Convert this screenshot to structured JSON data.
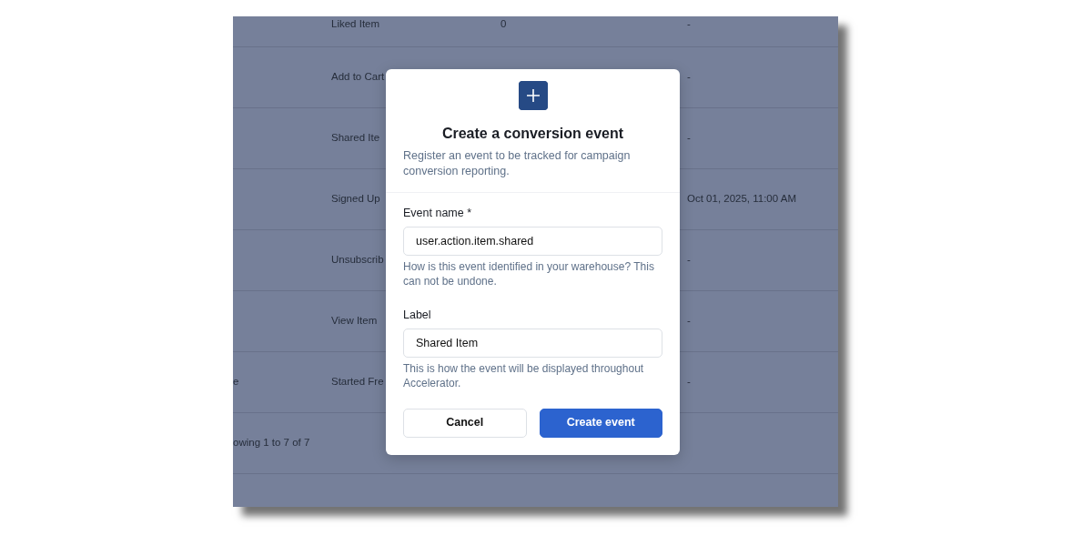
{
  "table": {
    "rows": [
      {
        "name": "Liked Item",
        "column_3": "0",
        "column_4": "-"
      },
      {
        "name": "Add to Cart",
        "column_4": "-"
      },
      {
        "name": "Shared Ite",
        "column_4": "-"
      },
      {
        "name": "Signed Up",
        "column_4": "Oct 01, 2025, 11:00 AM"
      },
      {
        "name": "Unsubscrib",
        "column_4": "-"
      },
      {
        "name": "View Item",
        "column_4": "-"
      },
      {
        "column_1": "e",
        "name": "Started Fre",
        "column_4": "-"
      }
    ],
    "footer": "owing 1 to 7 of 7"
  },
  "dialog": {
    "title": "Create a conversion event",
    "description": "Register an event to be tracked for campaign conversion reporting.",
    "fields": [
      {
        "label": "Event name *",
        "value": "user.action.item.shared",
        "help": "How is this event identified in your warehouse? This can not be undone."
      },
      {
        "label": "Label",
        "value": "Shared Item",
        "help": "This is how the event will be displayed throughout Accelerator."
      }
    ],
    "buttons": [
      {
        "label": "Cancel",
        "kind": "secondary"
      },
      {
        "label": "Create event",
        "kind": "primary"
      }
    ]
  }
}
